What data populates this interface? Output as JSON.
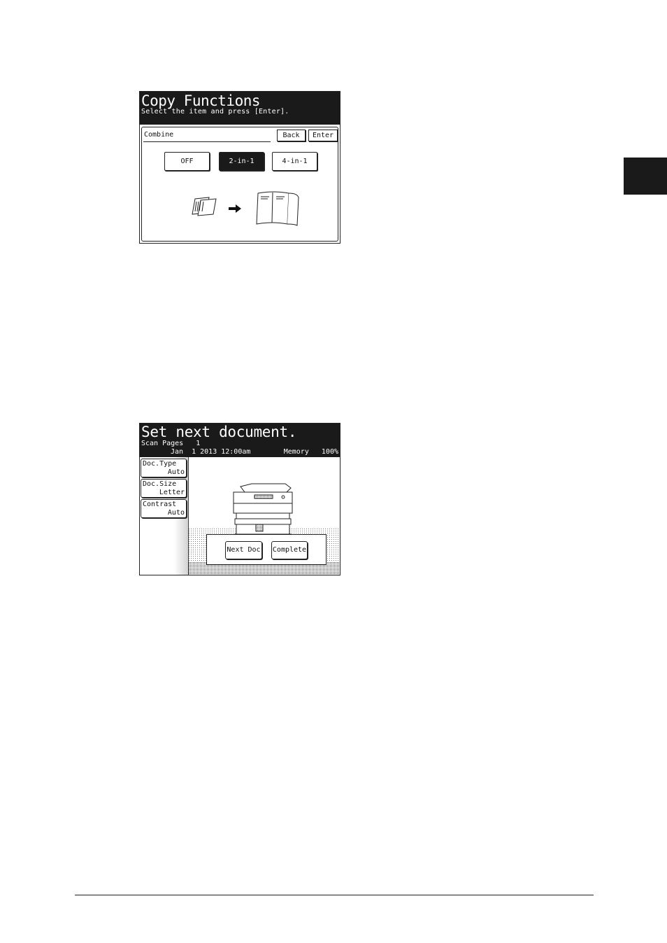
{
  "copy_functions": {
    "title": "Copy Functions",
    "subtitle": "Select the item and press [Enter].",
    "field_label": "Combine",
    "back_label": "Back",
    "enter_label": "Enter",
    "options": [
      "OFF",
      "2-in-1",
      "4-in-1"
    ],
    "selected_option": "2-in-1"
  },
  "scan_screen": {
    "title": "Set next document.",
    "scan_pages_label": "Scan Pages",
    "scan_pages_value": "1",
    "datetime": "Jan  1 2013 12:00am",
    "memory_label": "Memory",
    "memory_value": "100%",
    "side_buttons": [
      {
        "label": "Doc.Type",
        "value": "Auto"
      },
      {
        "label": "Doc.Size",
        "value": "Letter"
      },
      {
        "label": "Contrast",
        "value": "Auto"
      }
    ],
    "next_doc_label": "Next Doc",
    "complete_label": "Complete"
  },
  "colors": {
    "header_bg": "#1a1a1a",
    "chapter_tab": "#1a1a1a"
  }
}
